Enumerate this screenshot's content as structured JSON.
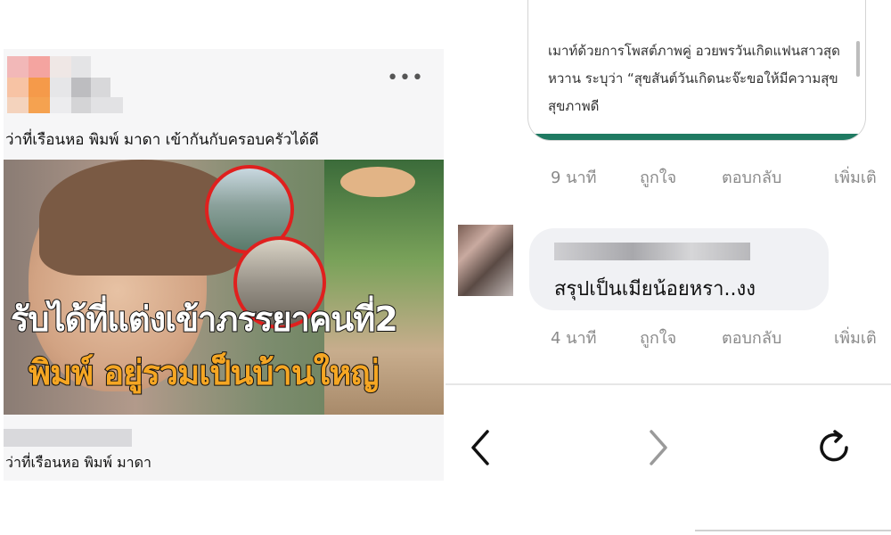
{
  "post": {
    "caption": "ว่าที่เรือนหอ พิมพ์ มาดา เข้ากันกับครอบครัวได้ดี",
    "more_icon": "ellipsis-icon",
    "thumbnail": {
      "headline_line1": "รับได้ที่แต่งเข้าภรรยาคนที่2",
      "headline_line2": "พิมพ์ อยู่รวมเป็นบ้านใหญ่",
      "headline_color_1": "#ffffff",
      "headline_color_2": "#f5a623",
      "circle_border_color": "#e0201e"
    },
    "source_title": "ว่าที่เรือนหอ พิมพ์ มาดา"
  },
  "comments": {
    "preview_text": "เมาท์ด้วยการโพสต์ภาพคู่ อวยพรวันเกิดแฟนสาวสุดหวาน ระบุว่า “สุขสันต์วันเกิดนะจ๊ะขอให้มีความสุขสุขภาพดี",
    "first_meta": {
      "time": "9 นาที",
      "like": "ถูกใจ",
      "reply": "ตอบกลับ",
      "more": "เพิ่มเติ"
    },
    "reply": {
      "text": "สรุปเป็นเมียน้อยหรา..งง"
    },
    "second_meta": {
      "time": "4 นาที",
      "like": "ถูกใจ",
      "reply": "ตอบกลับ",
      "more": "เพิ่มเติ"
    }
  },
  "nav": {
    "back_icon": "chevron-left-icon",
    "forward_icon": "chevron-right-icon",
    "reload_icon": "reload-icon"
  },
  "colors": {
    "accent_green": "#1f7a62",
    "meta_gray": "#8a8a8a",
    "bubble_bg": "#f0f1f4"
  }
}
